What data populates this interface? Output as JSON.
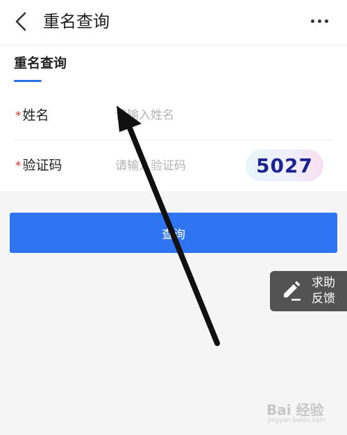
{
  "nav": {
    "title": "重名查询",
    "back_icon": "chevron-left-icon",
    "more_icon": "more-horizontal-icon"
  },
  "tab": {
    "label": "重名查询"
  },
  "form": {
    "name": {
      "required_mark": "*",
      "label": "姓名",
      "placeholder": "请输入姓名",
      "value": ""
    },
    "captcha": {
      "required_mark": "*",
      "label": "验证码",
      "placeholder": "请输入验证码",
      "value": "",
      "image_text": "5027"
    }
  },
  "query_button": {
    "label": "查询"
  },
  "help_button": {
    "text": "求助反馈",
    "icon": "edit-pen-icon"
  },
  "watermark": {
    "text": "Bai 经验",
    "sub": "jingyan.baidu.com"
  },
  "colors": {
    "accent": "#2f74f0",
    "required": "#e0312a",
    "captcha_text": "#1c2390",
    "help_bg": "#3c3c3c"
  }
}
